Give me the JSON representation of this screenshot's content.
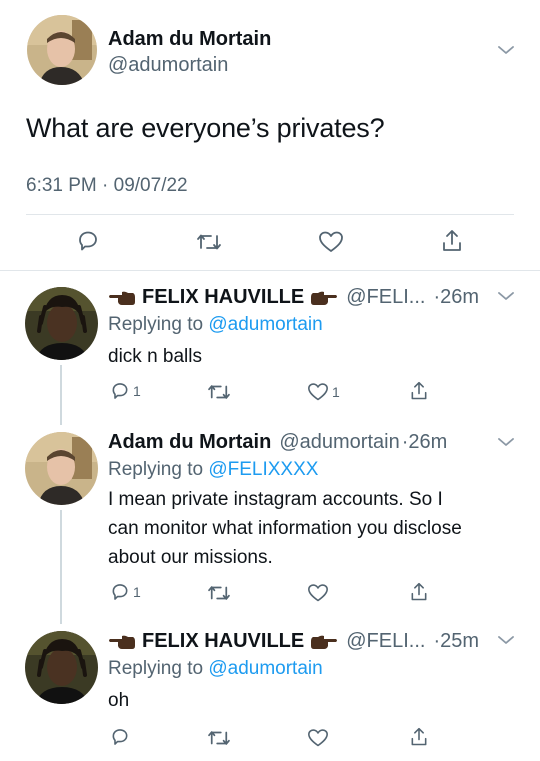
{
  "main_tweet": {
    "author_name": "Adam du Mortain",
    "author_handle": "@adumortain",
    "text": "What are everyone’s privates?",
    "timestamp": "6:31 PM · 09/07/22"
  },
  "replies": [
    {
      "author_name": "FELIX HAUVILLE",
      "author_handle": "@FELI...",
      "time": "·26m",
      "replying_prefix": "Replying to",
      "replying_handle": "@adumortain",
      "text": "dick n balls",
      "reply_count": "1",
      "retweet_count": "",
      "like_count": "1"
    },
    {
      "author_name": "Adam du Mortain",
      "author_handle": "@adumortain",
      "time": "·26m",
      "replying_prefix": "Replying to",
      "replying_handle": "@FELIXXXX",
      "text_lines": [
        "I mean private instagram accounts. So I",
        "can monitor what information you disclose",
        "about our missions."
      ],
      "reply_count": "1",
      "retweet_count": "",
      "like_count": ""
    },
    {
      "author_name": "FELIX HAUVILLE",
      "author_handle": "@FELI...",
      "time": "·25m",
      "replying_prefix": "Replying to",
      "replying_handle": "@adumortain",
      "text": "oh",
      "reply_count": "",
      "retweet_count": "",
      "like_count": ""
    }
  ],
  "colors": {
    "text": "#0f1419",
    "muted": "#536471",
    "link": "#1d9bf0",
    "divider": "#e1e6ea",
    "thread_line": "#cfd9de"
  },
  "icons": [
    "chevron-down-icon",
    "reply-icon",
    "retweet-icon",
    "like-icon",
    "share-icon",
    "pointing-hand-left-emoji",
    "pointing-hand-right-emoji"
  ]
}
